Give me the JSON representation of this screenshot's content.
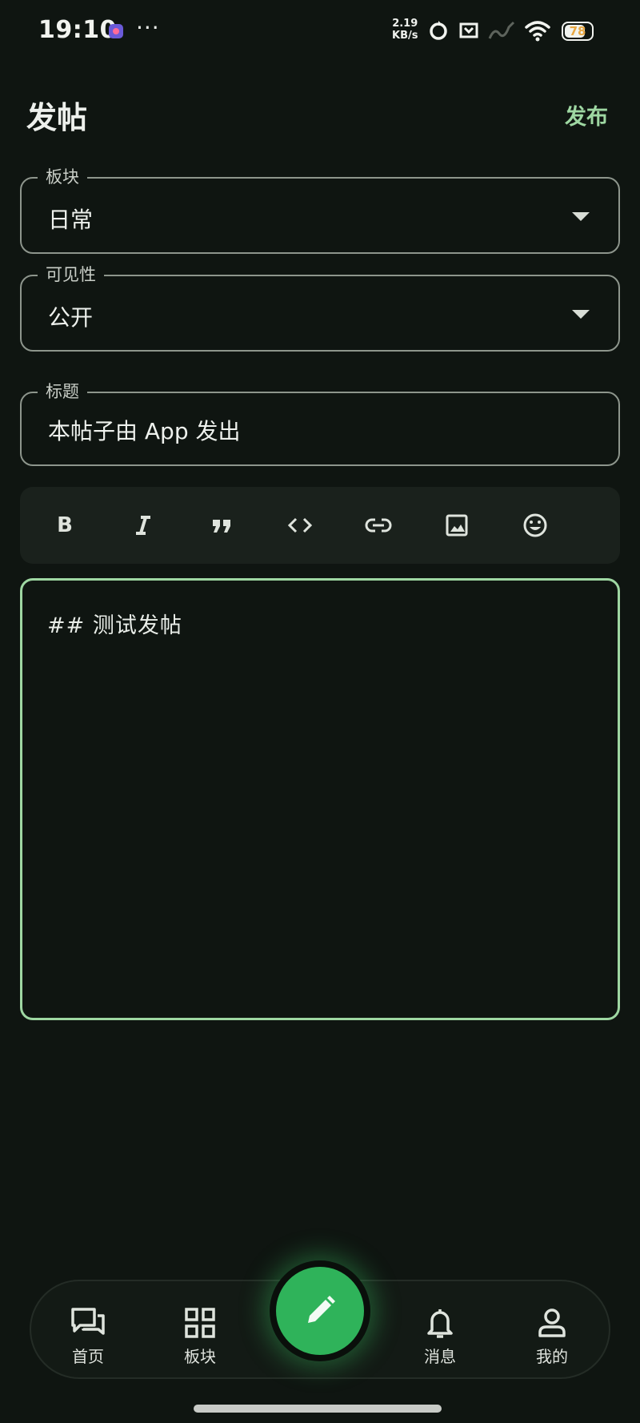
{
  "status_bar": {
    "time": "19:10",
    "more": "···",
    "net_speed_value": "2.19",
    "net_speed_unit": "KB/s",
    "battery_level": "78"
  },
  "header": {
    "title": "发帖",
    "publish_label": "发布"
  },
  "form": {
    "board": {
      "label": "板块",
      "value": "日常"
    },
    "visibility": {
      "label": "可见性",
      "value": "公开"
    },
    "title": {
      "label": "标题",
      "value": "本帖子由 App 发出"
    }
  },
  "toolbar": {
    "icons": [
      "bold-icon",
      "italic-icon",
      "quote-icon",
      "code-icon",
      "link-icon",
      "image-icon",
      "emoji-icon"
    ],
    "bold_glyph": "B"
  },
  "editor": {
    "content": "## 测试发帖"
  },
  "bottom_nav": {
    "items": [
      {
        "label": "首页",
        "icon": "chat-bubbles-icon"
      },
      {
        "label": "板块",
        "icon": "grid-icon"
      },
      {
        "label": "",
        "icon": "pencil-icon"
      },
      {
        "label": "消息",
        "icon": "bell-icon"
      },
      {
        "label": "我的",
        "icon": "person-icon"
      }
    ]
  },
  "colors": {
    "background": "#0f1511",
    "accent": "#9ed7a2",
    "fab": "#2fb35a"
  }
}
